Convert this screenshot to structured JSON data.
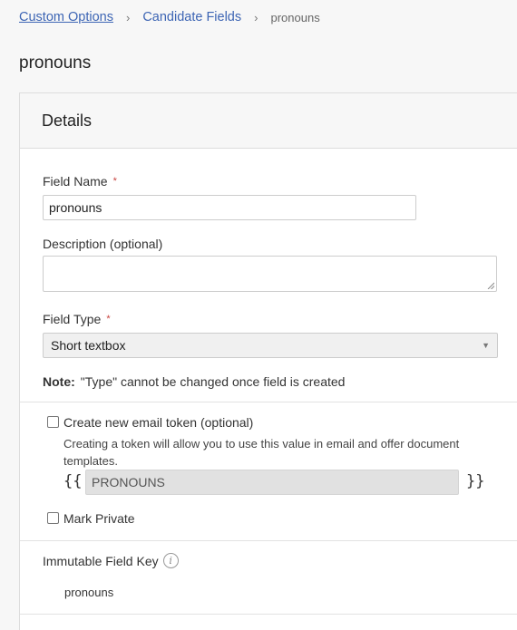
{
  "breadcrumb": {
    "items": [
      {
        "label": "Custom Options"
      },
      {
        "label": "Candidate Fields"
      }
    ],
    "current": "pronouns",
    "separator": "›"
  },
  "page": {
    "title": "pronouns"
  },
  "card": {
    "title": "Details",
    "field_name": {
      "label": "Field Name",
      "required_mark": "*",
      "value": "pronouns"
    },
    "description": {
      "label": "Description (optional)",
      "value": ""
    },
    "field_type": {
      "label": "Field Type",
      "required_mark": "*",
      "value": "Short textbox",
      "caret": "▼"
    },
    "note": {
      "prefix": "Note:",
      "text": "\"Type\" cannot be changed once field is created"
    },
    "email_token": {
      "checkbox_label": "Create new email token (optional)",
      "checked": false,
      "help": "Creating a token will allow you to use this value in email and offer document templates.",
      "open_brace": "{{",
      "close_brace": "}}",
      "token_value": "PRONOUNS"
    },
    "mark_private": {
      "label": "Mark Private",
      "checked": false
    },
    "immutable_key": {
      "label": "Immutable Field Key",
      "info_glyph": "i",
      "value": "pronouns"
    }
  },
  "colors": {
    "link": "#3d65b4",
    "required": "#c8423e",
    "border": "#dddddd"
  }
}
